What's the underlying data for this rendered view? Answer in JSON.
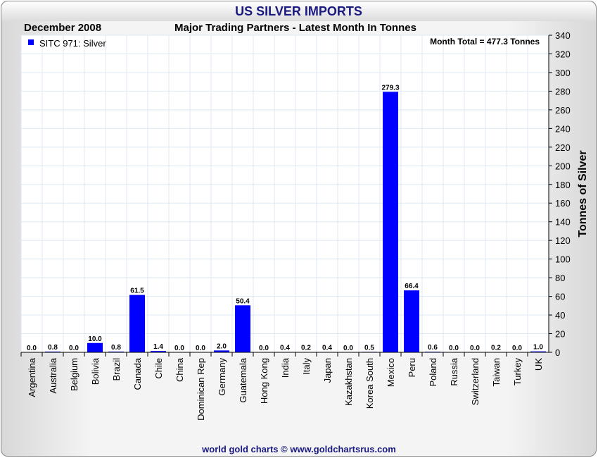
{
  "header": {
    "title": "US SILVER IMPORTS",
    "date": "December 2008",
    "footer": "world gold charts © www.goldchartsrus.com"
  },
  "chart_data": {
    "type": "bar",
    "title": "Major Trading Partners - Latest Month In Tonnes",
    "ylabel": "Tonnes of Silver",
    "xlabel": "",
    "ylim": [
      0,
      340
    ],
    "ytick_step": 20,
    "legend": {
      "label": "SITC 971: Silver",
      "placement": "top-left"
    },
    "annotation": "Month Total = 477.3 Tonnes",
    "bar_color": "#0000ff",
    "categories": [
      "Argentina",
      "Australia",
      "Belgium",
      "Bolivia",
      "Brazil",
      "Canada",
      "Chile",
      "China",
      "Dominican Rep",
      "Germany",
      "Guatemala",
      "Hong Kong",
      "India",
      "Italy",
      "Japan",
      "Kazakhstan",
      "Korea South",
      "Mexico",
      "Peru",
      "Poland",
      "Russia",
      "Switzerland",
      "Taiwan",
      "Turkey",
      "UK"
    ],
    "values": [
      0.0,
      0.8,
      0.0,
      10.0,
      0.8,
      61.5,
      1.4,
      0.0,
      0.0,
      2.0,
      50.4,
      0.0,
      0.4,
      0.2,
      0.4,
      0.0,
      0.5,
      279.3,
      66.4,
      0.6,
      0.0,
      0.0,
      0.2,
      0.0,
      1.0
    ],
    "grid": true
  }
}
